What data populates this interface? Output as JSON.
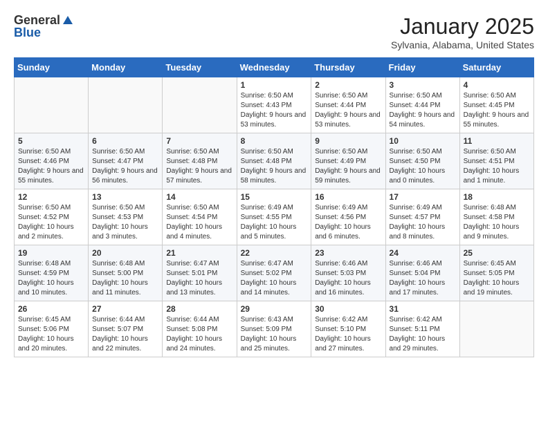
{
  "header": {
    "logo_general": "General",
    "logo_blue": "Blue",
    "month": "January 2025",
    "location": "Sylvania, Alabama, United States"
  },
  "weekdays": [
    "Sunday",
    "Monday",
    "Tuesday",
    "Wednesday",
    "Thursday",
    "Friday",
    "Saturday"
  ],
  "weeks": [
    [
      {
        "day": "",
        "info": ""
      },
      {
        "day": "",
        "info": ""
      },
      {
        "day": "",
        "info": ""
      },
      {
        "day": "1",
        "info": "Sunrise: 6:50 AM\nSunset: 4:43 PM\nDaylight: 9 hours and 53 minutes."
      },
      {
        "day": "2",
        "info": "Sunrise: 6:50 AM\nSunset: 4:44 PM\nDaylight: 9 hours and 53 minutes."
      },
      {
        "day": "3",
        "info": "Sunrise: 6:50 AM\nSunset: 4:44 PM\nDaylight: 9 hours and 54 minutes."
      },
      {
        "day": "4",
        "info": "Sunrise: 6:50 AM\nSunset: 4:45 PM\nDaylight: 9 hours and 55 minutes."
      }
    ],
    [
      {
        "day": "5",
        "info": "Sunrise: 6:50 AM\nSunset: 4:46 PM\nDaylight: 9 hours and 55 minutes."
      },
      {
        "day": "6",
        "info": "Sunrise: 6:50 AM\nSunset: 4:47 PM\nDaylight: 9 hours and 56 minutes."
      },
      {
        "day": "7",
        "info": "Sunrise: 6:50 AM\nSunset: 4:48 PM\nDaylight: 9 hours and 57 minutes."
      },
      {
        "day": "8",
        "info": "Sunrise: 6:50 AM\nSunset: 4:48 PM\nDaylight: 9 hours and 58 minutes."
      },
      {
        "day": "9",
        "info": "Sunrise: 6:50 AM\nSunset: 4:49 PM\nDaylight: 9 hours and 59 minutes."
      },
      {
        "day": "10",
        "info": "Sunrise: 6:50 AM\nSunset: 4:50 PM\nDaylight: 10 hours and 0 minutes."
      },
      {
        "day": "11",
        "info": "Sunrise: 6:50 AM\nSunset: 4:51 PM\nDaylight: 10 hours and 1 minute."
      }
    ],
    [
      {
        "day": "12",
        "info": "Sunrise: 6:50 AM\nSunset: 4:52 PM\nDaylight: 10 hours and 2 minutes."
      },
      {
        "day": "13",
        "info": "Sunrise: 6:50 AM\nSunset: 4:53 PM\nDaylight: 10 hours and 3 minutes."
      },
      {
        "day": "14",
        "info": "Sunrise: 6:50 AM\nSunset: 4:54 PM\nDaylight: 10 hours and 4 minutes."
      },
      {
        "day": "15",
        "info": "Sunrise: 6:49 AM\nSunset: 4:55 PM\nDaylight: 10 hours and 5 minutes."
      },
      {
        "day": "16",
        "info": "Sunrise: 6:49 AM\nSunset: 4:56 PM\nDaylight: 10 hours and 6 minutes."
      },
      {
        "day": "17",
        "info": "Sunrise: 6:49 AM\nSunset: 4:57 PM\nDaylight: 10 hours and 8 minutes."
      },
      {
        "day": "18",
        "info": "Sunrise: 6:48 AM\nSunset: 4:58 PM\nDaylight: 10 hours and 9 minutes."
      }
    ],
    [
      {
        "day": "19",
        "info": "Sunrise: 6:48 AM\nSunset: 4:59 PM\nDaylight: 10 hours and 10 minutes."
      },
      {
        "day": "20",
        "info": "Sunrise: 6:48 AM\nSunset: 5:00 PM\nDaylight: 10 hours and 11 minutes."
      },
      {
        "day": "21",
        "info": "Sunrise: 6:47 AM\nSunset: 5:01 PM\nDaylight: 10 hours and 13 minutes."
      },
      {
        "day": "22",
        "info": "Sunrise: 6:47 AM\nSunset: 5:02 PM\nDaylight: 10 hours and 14 minutes."
      },
      {
        "day": "23",
        "info": "Sunrise: 6:46 AM\nSunset: 5:03 PM\nDaylight: 10 hours and 16 minutes."
      },
      {
        "day": "24",
        "info": "Sunrise: 6:46 AM\nSunset: 5:04 PM\nDaylight: 10 hours and 17 minutes."
      },
      {
        "day": "25",
        "info": "Sunrise: 6:45 AM\nSunset: 5:05 PM\nDaylight: 10 hours and 19 minutes."
      }
    ],
    [
      {
        "day": "26",
        "info": "Sunrise: 6:45 AM\nSunset: 5:06 PM\nDaylight: 10 hours and 20 minutes."
      },
      {
        "day": "27",
        "info": "Sunrise: 6:44 AM\nSunset: 5:07 PM\nDaylight: 10 hours and 22 minutes."
      },
      {
        "day": "28",
        "info": "Sunrise: 6:44 AM\nSunset: 5:08 PM\nDaylight: 10 hours and 24 minutes."
      },
      {
        "day": "29",
        "info": "Sunrise: 6:43 AM\nSunset: 5:09 PM\nDaylight: 10 hours and 25 minutes."
      },
      {
        "day": "30",
        "info": "Sunrise: 6:42 AM\nSunset: 5:10 PM\nDaylight: 10 hours and 27 minutes."
      },
      {
        "day": "31",
        "info": "Sunrise: 6:42 AM\nSunset: 5:11 PM\nDaylight: 10 hours and 29 minutes."
      },
      {
        "day": "",
        "info": ""
      }
    ]
  ]
}
